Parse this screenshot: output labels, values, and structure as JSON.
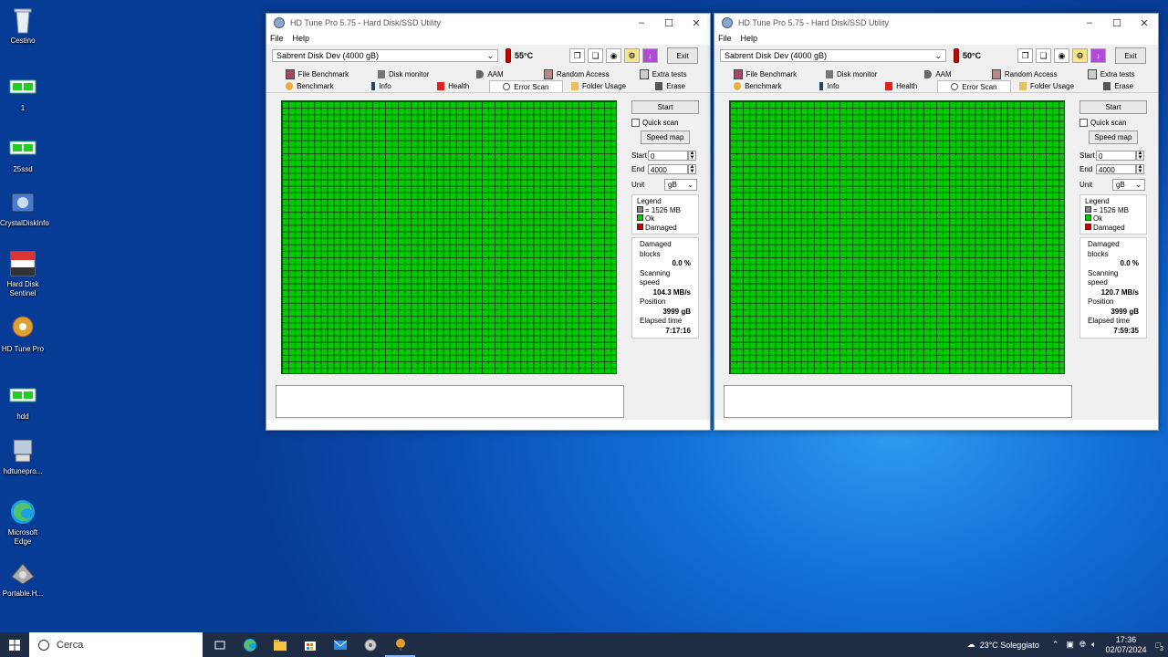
{
  "desktop": {
    "icons": [
      {
        "label": "Cestino",
        "icon": "recycle-bin-icon"
      },
      {
        "label": "1",
        "icon": "drive-icon"
      },
      {
        "label": "25ssd",
        "icon": "drive-icon"
      },
      {
        "label": "CrystalDiskInfo",
        "icon": "crystaldiskinfo-icon"
      },
      {
        "label": "Hard Disk Sentinel",
        "icon": "hard-disk-sentinel-icon"
      },
      {
        "label": "HD Tune Pro",
        "icon": "hd-tune-pro-icon"
      },
      {
        "label": "hdd",
        "icon": "drive-icon"
      },
      {
        "label": "hdtunepro...",
        "icon": "installer-icon"
      },
      {
        "label": "Microsoft Edge",
        "icon": "edge-icon"
      },
      {
        "label": "Portable.H...",
        "icon": "portable-hd-icon"
      }
    ]
  },
  "windows": [
    {
      "title": "HD Tune Pro 5.75 - Hard Disk/SSD Utility",
      "menu": [
        "File",
        "Help"
      ],
      "drive": "Sabrent Disk Dev (4000 gB)",
      "temperature": "55°C",
      "exit_label": "Exit",
      "tabs_row1": [
        "File Benchmark",
        "Disk monitor",
        "AAM",
        "Random Access",
        "Extra tests"
      ],
      "tabs_row2": [
        "Benchmark",
        "Info",
        "Health",
        "Error Scan",
        "Folder Usage",
        "Erase"
      ],
      "active_tab": "Error Scan",
      "start_label": "Start",
      "quick_scan_label": "Quick scan",
      "speed_map_label": "Speed map",
      "start_field_label": "Start",
      "start_value": "0",
      "end_field_label": "End",
      "end_value": "4000",
      "unit_label": "Unit",
      "unit_value": "gB",
      "legend_title": "Legend",
      "legend_block": "= 1526 MB",
      "legend_ok": "Ok",
      "legend_damaged": "Damaged",
      "damaged_blocks_label": "Damaged blocks",
      "damaged_blocks": "0.0 %",
      "scanning_speed_label": "Scanning speed",
      "scanning_speed": "104.3 MB/s",
      "position_label": "Position",
      "position": "3999 gB",
      "elapsed_label": "Elapsed time",
      "elapsed": "7:17:16"
    },
    {
      "title": "HD Tune Pro 5.75 - Hard Disk/SSD Utility",
      "menu": [
        "File",
        "Help"
      ],
      "drive": "Sabrent Disk Dev (4000 gB)",
      "temperature": "50°C",
      "exit_label": "Exit",
      "tabs_row1": [
        "File Benchmark",
        "Disk monitor",
        "AAM",
        "Random Access",
        "Extra tests"
      ],
      "tabs_row2": [
        "Benchmark",
        "Info",
        "Health",
        "Error Scan",
        "Folder Usage",
        "Erase"
      ],
      "active_tab": "Error Scan",
      "start_label": "Start",
      "quick_scan_label": "Quick scan",
      "speed_map_label": "Speed map",
      "start_field_label": "Start",
      "start_value": "0",
      "end_field_label": "End",
      "end_value": "4000",
      "unit_label": "Unit",
      "unit_value": "gB",
      "legend_title": "Legend",
      "legend_block": "= 1526 MB",
      "legend_ok": "Ok",
      "legend_damaged": "Damaged",
      "damaged_blocks_label": "Damaged blocks",
      "damaged_blocks": "0.0 %",
      "scanning_speed_label": "Scanning speed",
      "scanning_speed": "120.7 MB/s",
      "position_label": "Position",
      "position": "3999 gB",
      "elapsed_label": "Elapsed time",
      "elapsed": "7:59:35"
    }
  ],
  "taskbar": {
    "search_placeholder": "Cerca",
    "weather": "23°C Soleggiato",
    "time": "17:36",
    "date": "02/07/2024",
    "notification_count": "3"
  },
  "colors": {
    "ok_block": "#00cc00",
    "damaged_block": "#cc0000",
    "grid_line": "#1a4a1a"
  }
}
